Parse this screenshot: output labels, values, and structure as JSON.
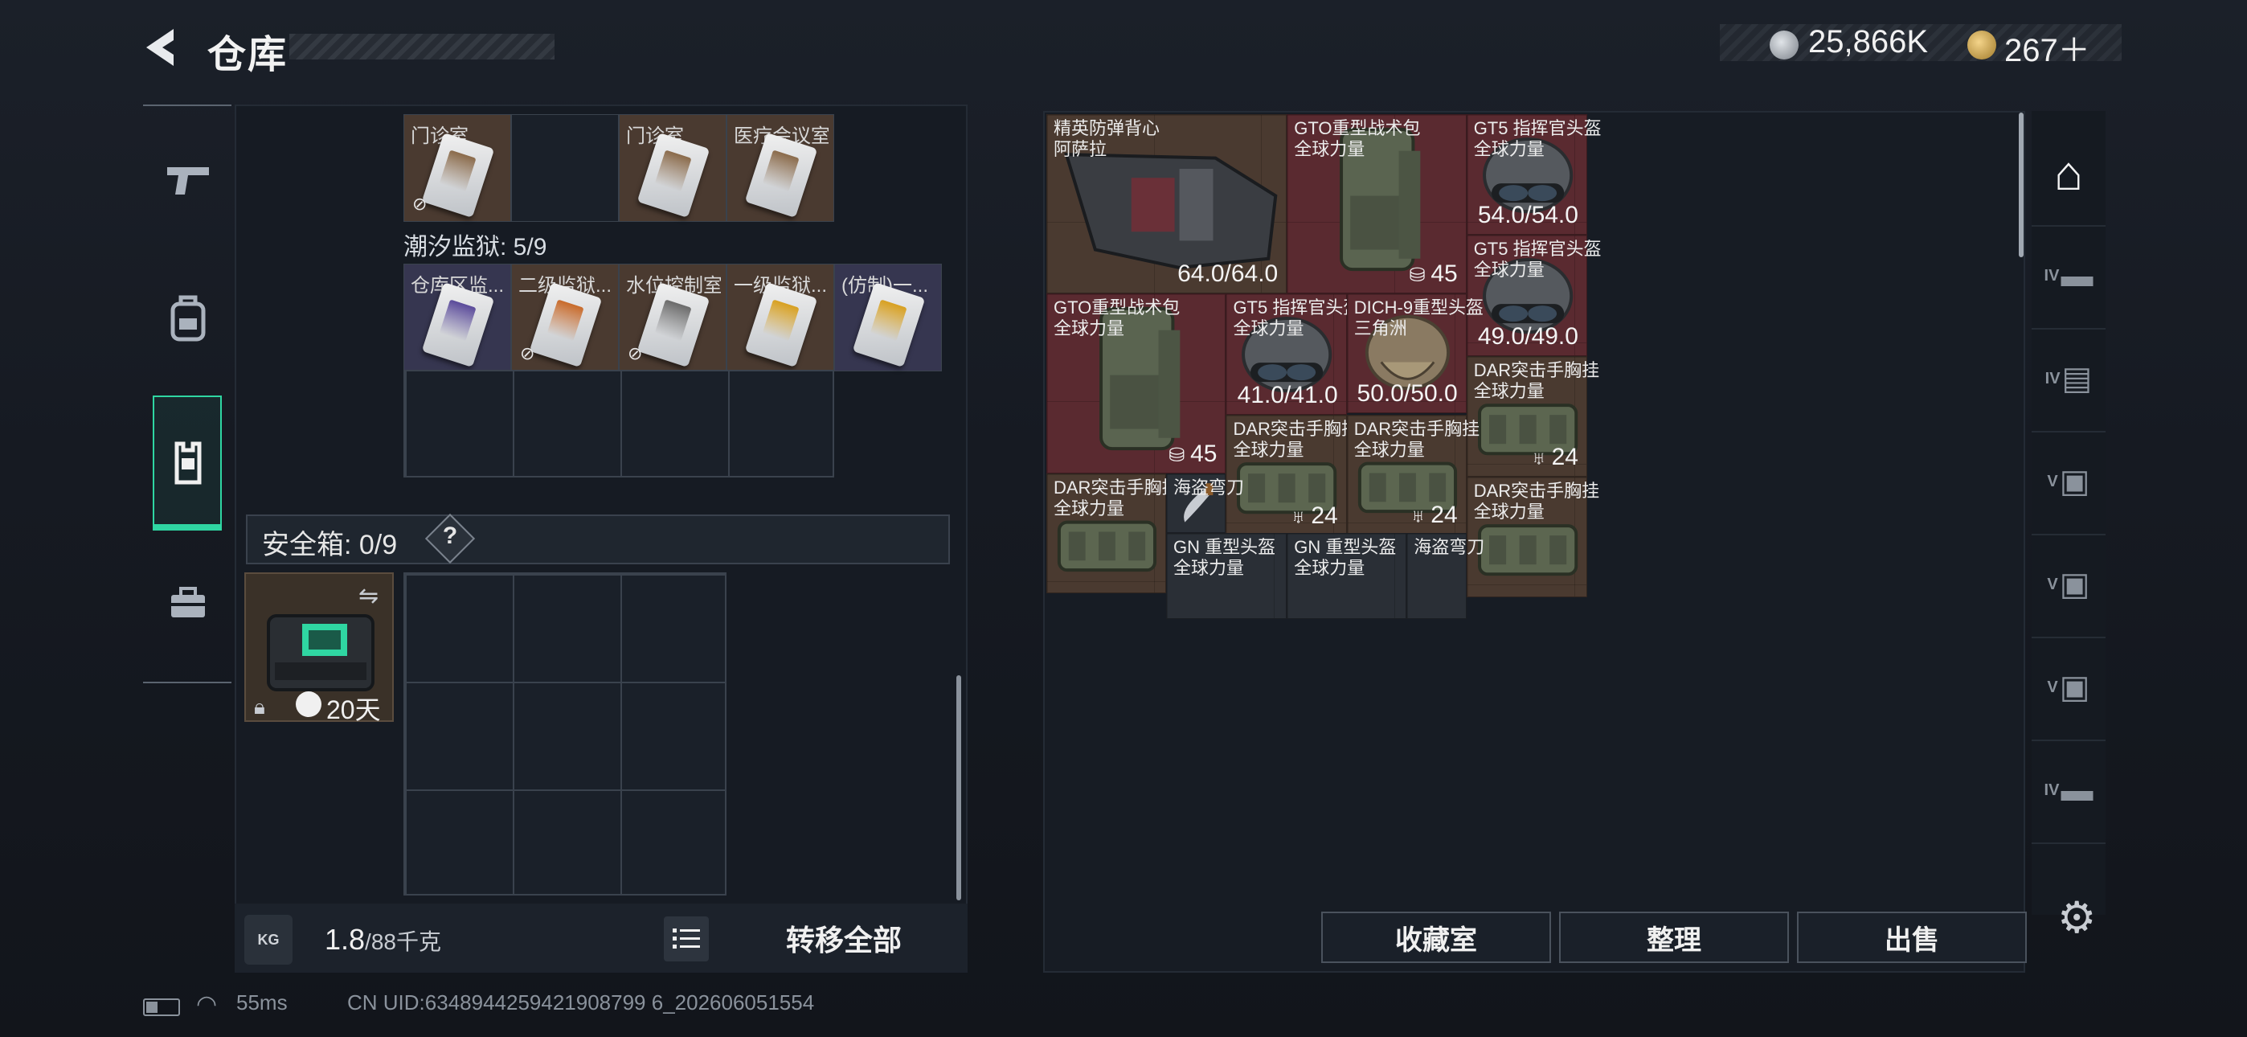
{
  "header": {
    "title": "仓库",
    "currency1": {
      "icon": "coin-silver-icon",
      "value": "25,866K"
    },
    "currency2": {
      "icon": "coin-gold-icon",
      "value": "267＋"
    }
  },
  "left_nav": [
    {
      "icon": "pistol-icon",
      "active": false
    },
    {
      "icon": "backpack-icon",
      "active": false
    },
    {
      "icon": "vest-icon",
      "active": true
    },
    {
      "icon": "toolbox-icon",
      "active": false
    }
  ],
  "keycards": {
    "row1": [
      {
        "label": "门诊室",
        "bg": "brown",
        "no_car": true,
        "color": "#8a6a4a"
      },
      {
        "label": "",
        "bg": "empty",
        "no_car": false
      },
      {
        "label": "门诊室",
        "bg": "brown",
        "no_car": false,
        "color": "#8a6a4a"
      },
      {
        "label": "医疗会议室",
        "bg": "brown",
        "no_car": false,
        "color": "#8a6a4a"
      }
    ],
    "section_title": "潮汐监狱: 5/9",
    "row2": [
      {
        "label": "仓库区监...",
        "bg": "purp",
        "no_car": false,
        "color": "#5a4a9a"
      },
      {
        "label": "二级监狱...",
        "bg": "brown",
        "no_car": true,
        "color": "#c86a2a"
      },
      {
        "label": "水位控制室",
        "bg": "brown",
        "no_car": true,
        "color": "#6a6a6a"
      },
      {
        "label": "一级监狱...",
        "bg": "brown",
        "no_car": false,
        "color": "#d8a020"
      },
      {
        "label": "(仿制)一...",
        "bg": "purp",
        "no_car": false,
        "color": "#d8a020"
      }
    ]
  },
  "safebox": {
    "label": "安全箱: 0/9",
    "help": "?",
    "timer": "20天"
  },
  "footer_left": {
    "weight_value": "1.8",
    "weight_max": "/88千克",
    "kg_label": "KG",
    "transfer_label": "转移全部"
  },
  "items": [
    {
      "name": "精英防弹背心",
      "sub": "阿萨拉",
      "bg": "brw",
      "value": "64.0/64.0",
      "kind": "vest"
    },
    {
      "name": "GTO重型战术包",
      "sub": "全球力量",
      "bg": "red",
      "value": "45",
      "kind": "backpack"
    },
    {
      "name": "GT5 指挥官头盔",
      "sub": "全球力量",
      "bg": "red",
      "value": "54.0/54.0",
      "kind": "helmet"
    },
    {
      "name": "GT5 指挥官头盔",
      "sub": "全球力量",
      "bg": "red",
      "value": "49.0/49.0",
      "kind": "helmet"
    },
    {
      "name": "GTO重型战术包",
      "sub": "全球力量",
      "bg": "red",
      "value": "45",
      "kind": "backpack"
    },
    {
      "name": "GT5 指挥官头盔",
      "sub": "全球力量",
      "bg": "red",
      "value": "41.0/41.0",
      "kind": "helmet"
    },
    {
      "name": "DICH-9重型头盔",
      "sub": "三角洲",
      "bg": "red",
      "value": "50.0/50.0",
      "kind": "helmet2"
    },
    {
      "name": "DAR突击手胸挂",
      "sub": "全球力量",
      "bg": "brw",
      "value": "24",
      "kind": "rig"
    },
    {
      "name": "DAR突击手胸挂",
      "sub": "全球力量",
      "bg": "brw",
      "value": "24",
      "kind": "rig"
    },
    {
      "name": "DAR突击手胸挂",
      "sub": "全球力量",
      "bg": "brw",
      "value": "24",
      "kind": "rig"
    },
    {
      "name": "DAR突击手胸挂",
      "sub": "全球力量",
      "bg": "brw",
      "value": "",
      "kind": "rig"
    },
    {
      "name": "海盗弯刀",
      "sub": "",
      "bg": "gry",
      "value": "",
      "kind": "knife"
    },
    {
      "name": "DAR突击手胸挂",
      "sub": "全球力量",
      "bg": "brw",
      "value": "",
      "kind": "rig"
    },
    {
      "name": "GN 重型头盔",
      "sub": "全球力量",
      "bg": "gry",
      "value": "",
      "kind": "none"
    },
    {
      "name": "GN 重型头盔",
      "sub": "全球力量",
      "bg": "gry",
      "value": "",
      "kind": "none"
    },
    {
      "name": "海盗弯刀",
      "sub": "",
      "bg": "gry",
      "value": "",
      "kind": "none"
    }
  ],
  "right_buttons": {
    "collection": "收藏室",
    "sort": "整理",
    "sell": "出售"
  },
  "right_nav": [
    {
      "tier": "",
      "icon": "home-icon"
    },
    {
      "tier": "IV",
      "icon": "rifle-icon"
    },
    {
      "tier": "IV",
      "icon": "folder-icon"
    },
    {
      "tier": "V",
      "icon": "camera-icon"
    },
    {
      "tier": "V",
      "icon": "camera-icon"
    },
    {
      "tier": "V",
      "icon": "camera-icon"
    },
    {
      "tier": "IV",
      "icon": "rifle-icon"
    }
  ],
  "status": {
    "ping": "55ms",
    "uid": "CN UID:6348944259421908799 6_202606051554"
  },
  "colors": {
    "accent": "#2fd6a2",
    "item_red": "#5a2a30",
    "item_brown": "#4a3a30"
  }
}
